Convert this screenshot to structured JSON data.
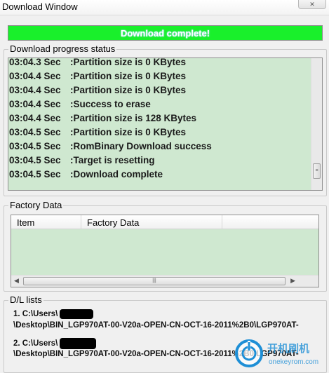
{
  "window": {
    "title": "Download Window",
    "close_glyph": "✕"
  },
  "progress": {
    "label": "Download complete!",
    "percent": 100,
    "color": "#19f02b"
  },
  "status": {
    "legend": "Download progress status",
    "lines": [
      {
        "time": "03:04.3 Sec",
        "message": ":Partition size is 0 KBytes"
      },
      {
        "time": "03:04.4 Sec",
        "message": ":Partition size is 0 KBytes"
      },
      {
        "time": "03:04.4 Sec",
        "message": ":Partition size is 0 KBytes"
      },
      {
        "time": "03:04.4 Sec",
        "message": ":Success to erase"
      },
      {
        "time": "03:04.4 Sec",
        "message": ":Partition size is 128 KBytes"
      },
      {
        "time": "03:04.5 Sec",
        "message": ":Partition size is 0 KBytes"
      },
      {
        "time": "03:04.5 Sec",
        "message": ":RomBinary Download success"
      },
      {
        "time": "03:04.5 Sec",
        "message": ":Target is resetting"
      },
      {
        "time": "03:04.5 Sec",
        "message": ":Download complete"
      }
    ],
    "scroll_grip": "≡"
  },
  "factory": {
    "legend": "Factory Data",
    "columns": [
      "Item",
      "Factory Data"
    ],
    "rows": [],
    "scroll_left": "◀",
    "scroll_right": "▶",
    "scroll_grip": "|||"
  },
  "dl_lists": {
    "legend": "D/L lists",
    "items": [
      {
        "line1": "1. C:\\Users\\",
        "line2": "\\Desktop\\BIN_LGP970AT-00-V20a-OPEN-CN-OCT-16-2011%2B0\\LGP970AT-"
      },
      {
        "line1": "2. C:\\Users\\",
        "line2": "\\Desktop\\BIN_LGP970AT-00-V20a-OPEN-CN-OCT-16-2011%2B0\\LGP970AT-"
      }
    ]
  },
  "watermark": {
    "text": "开机刷机",
    "subtext": "onekeyrom.com",
    "color": "#1e8fd6"
  },
  "colors": {
    "panel_bg": "#cfe8d0",
    "window_bg": "#f0f0f0"
  }
}
